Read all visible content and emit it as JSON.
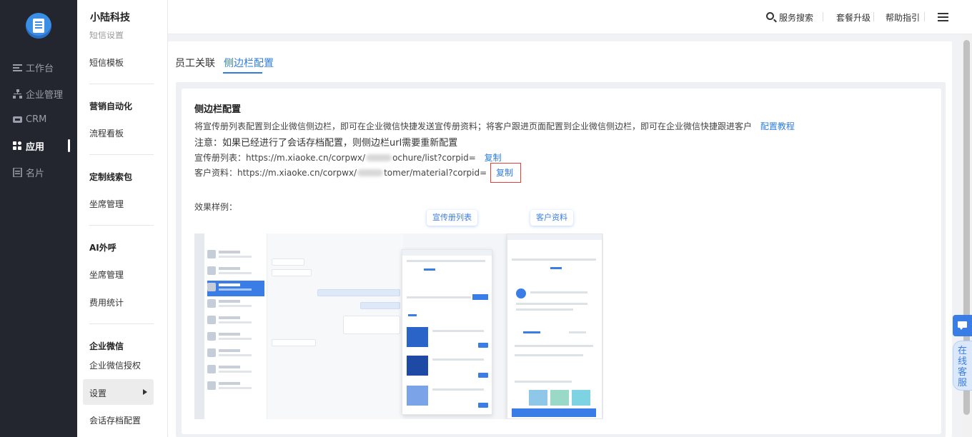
{
  "rail": {
    "items": [
      {
        "label": "工作台",
        "icon": "menu-icon"
      },
      {
        "label": "企业管理",
        "icon": "org-tree-icon"
      },
      {
        "label": "CRM",
        "icon": "crm-icon"
      },
      {
        "label": "应用",
        "icon": "apps-grid-icon"
      },
      {
        "label": "名片",
        "icon": "card-icon"
      }
    ],
    "active": "应用"
  },
  "submenu": {
    "brand": "小陆科技",
    "cut_item": "短信设置",
    "items": {
      "sms_template": "短信模板",
      "marketing_group": "营销自动化",
      "flow_board": "流程看板",
      "custom_leads_group": "定制线索包",
      "seat_mgmt_1": "坐席管理",
      "ai_call_group": "AI外呼",
      "seat_mgmt_2": "坐席管理",
      "fee_stats": "费用统计",
      "wecom_group": "企业微信",
      "wecom_auth": "企业微信授权",
      "settings": "设置",
      "archive_config": "会话存档配置"
    }
  },
  "topbar": {
    "search": "服务搜索",
    "upgrade": "套餐升级",
    "help": "帮助指引"
  },
  "tabs": [
    "员工关联",
    "侧边栏配置"
  ],
  "card": {
    "title": "侧边栏配置",
    "desc": "将宣传册列表配置到企业微信侧边栏，即可在企业微信快捷发送宣传册资料；将客户跟进页面配置到企业微信侧边栏，即可在企业微信快捷跟进客户",
    "tutorial_link": "配置教程",
    "note": "注意：如果已经进行了会话存档配置，则侧边栏url需要重新配置",
    "brochure_prefix": "宣传册列表：https://m.xiaoke.cn/corpwx/",
    "brochure_suffix": "ochure/list?corpid=",
    "customer_prefix": "客户资料：https://m.xiaoke.cn/corpwx/",
    "customer_suffix": "tomer/material?corpid=",
    "copy_label": "复制",
    "example_label": "效果样例："
  },
  "preview": {
    "brochure_tag": "宣传册列表",
    "customer_tag": "客户资料"
  },
  "float": {
    "service_label": "在线客服"
  },
  "colors": {
    "accent": "#2f7de1",
    "rail_bg": "#23262e",
    "highlight_border": "#e4423a"
  }
}
